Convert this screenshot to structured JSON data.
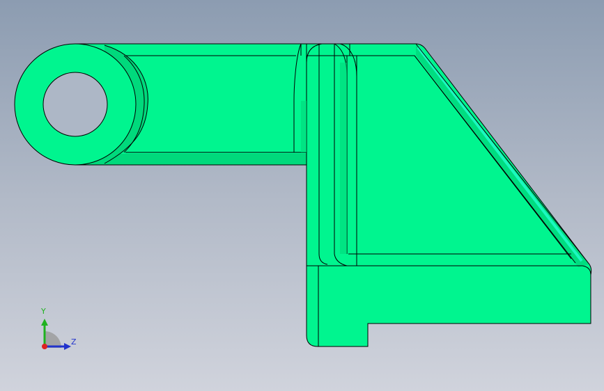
{
  "viewport": {
    "background_top": "#8c9cb1",
    "background_bottom": "#d0d3dc",
    "part_color": "#00f58f",
    "part_shade": "#00d97c",
    "edge_color": "#000000"
  },
  "triad": {
    "y_label": "Y",
    "z_label": "Z",
    "y_color": "#1fb21f",
    "z_color": "#2233cc",
    "x_color": "#dd2222"
  }
}
